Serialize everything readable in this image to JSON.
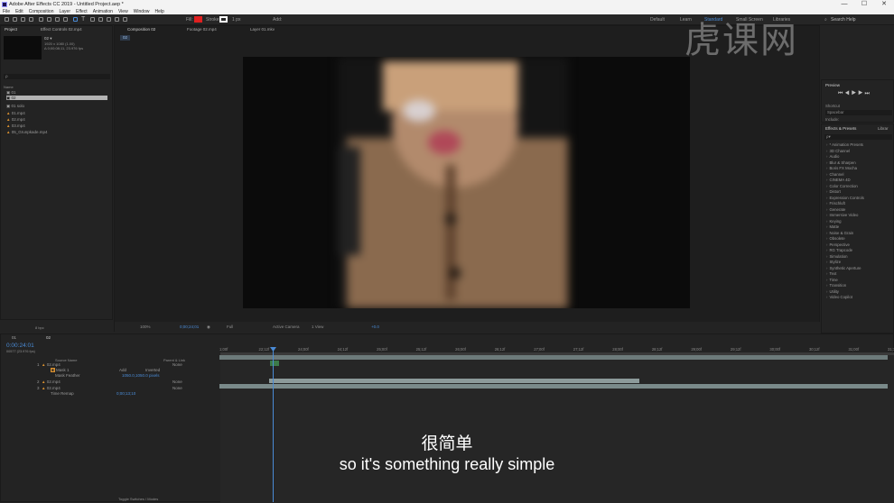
{
  "window": {
    "title": "Adobe After Effects CC 2019 - Untitled Project.aep *",
    "controls": [
      "—",
      "☐",
      "✕"
    ]
  },
  "menu": [
    "File",
    "Edit",
    "Composition",
    "Layer",
    "Effect",
    "Animation",
    "View",
    "Window",
    "Help"
  ],
  "toolbar": {
    "fill_label": "Fill:",
    "stroke_label": "Stroke:",
    "stroke_value": "1 px",
    "add_label": "Add:",
    "fill_color": "#e02020",
    "stroke_color": "#ffffff",
    "workspaces": [
      "Default",
      "Learn",
      "Standard",
      "Small Screen",
      "Libraries"
    ],
    "search_placeholder": "Search Help"
  },
  "project": {
    "tab": "Project",
    "effect_controls_tab": "Effect Controls 02.mp4",
    "comp_name": "02 ▾",
    "comp_info1": "1920 x 1080 (1.00)",
    "comp_info2": "Δ 0;00;08;11, 23.976 fps",
    "name_col": "Name",
    "items": [
      "01",
      "02",
      "01 solo",
      "01.mp4",
      "02.mp4",
      "03.mp4",
      "05_Grunpkade.mp4"
    ],
    "bpc": "8 bpc"
  },
  "composition": {
    "tab": "Composition 02",
    "footage_tab": "Footage 02.mp4",
    "layer_tab": "Layer 01.mkv",
    "breadcrumb": "02",
    "zoom": "100%",
    "timecode": "0;00;24;01",
    "resolution": "Full",
    "camera": "Active Camera",
    "views": "1 View",
    "offset": "+0.0"
  },
  "preview": {
    "tab": "Preview",
    "shortcut_label": "Shortcut",
    "shortcut_value": "Spacebar",
    "include_label": "Include:"
  },
  "effects": {
    "tab": "Effects & Presets",
    "libraries_tab": "Librar",
    "search_placeholder": "ρ▾",
    "items": [
      "* Animation Presets",
      "3D Channel",
      "Audio",
      "Blur & Sharpen",
      "Boris FX Mocha",
      "Channel",
      "CINEMA 4D",
      "Color Correction",
      "Distort",
      "Expression Controls",
      "Frischluft",
      "Generate",
      "Immersive Video",
      "Keying",
      "Matte",
      "Noise & Grain",
      "Obsolete",
      "Perspective",
      "RG Trapcode",
      "Simulation",
      "Stylize",
      "Synthetic Aperture",
      "Text",
      "Time",
      "Transition",
      "Utility",
      "Video Copilot"
    ]
  },
  "timeline": {
    "tab": "02",
    "render_tab": "01",
    "timecode": "0:00:24:01",
    "timecode_sub": "00577 (23.976 fps)",
    "col_source": "Source Name",
    "col_parent": "Parent & Link",
    "layers": [
      {
        "num": "1",
        "name": "02.mp4",
        "parent": "None"
      },
      {
        "num": "",
        "name": "Mask 1",
        "mode": "Add",
        "inverted": "Inverted"
      },
      {
        "num": "",
        "name": "Mask Feather",
        "value": "1050.0,1050.0 pixels"
      },
      {
        "num": "2",
        "name": "02.mp4",
        "parent": "None"
      },
      {
        "num": "3",
        "name": "02.mp4",
        "parent": "None"
      },
      {
        "num": "",
        "name": "Time Remap",
        "value": "0;00;13;10"
      }
    ],
    "ticks": [
      "1;00f",
      "22;12f",
      "24;00f",
      "24;12f",
      "25;00f",
      "25;12f",
      "26;00f",
      "26;12f",
      "27;00f",
      "27;12f",
      "28;00f",
      "28;12f",
      "29;00f",
      "29;12f",
      "30;00f",
      "30;12f",
      "31;00f",
      "31;12f"
    ],
    "toggle_label": "Toggle Switches / Modes"
  },
  "subtitle": {
    "cn": "很简单",
    "en": "so it's something really simple"
  },
  "watermark": "虎课网"
}
